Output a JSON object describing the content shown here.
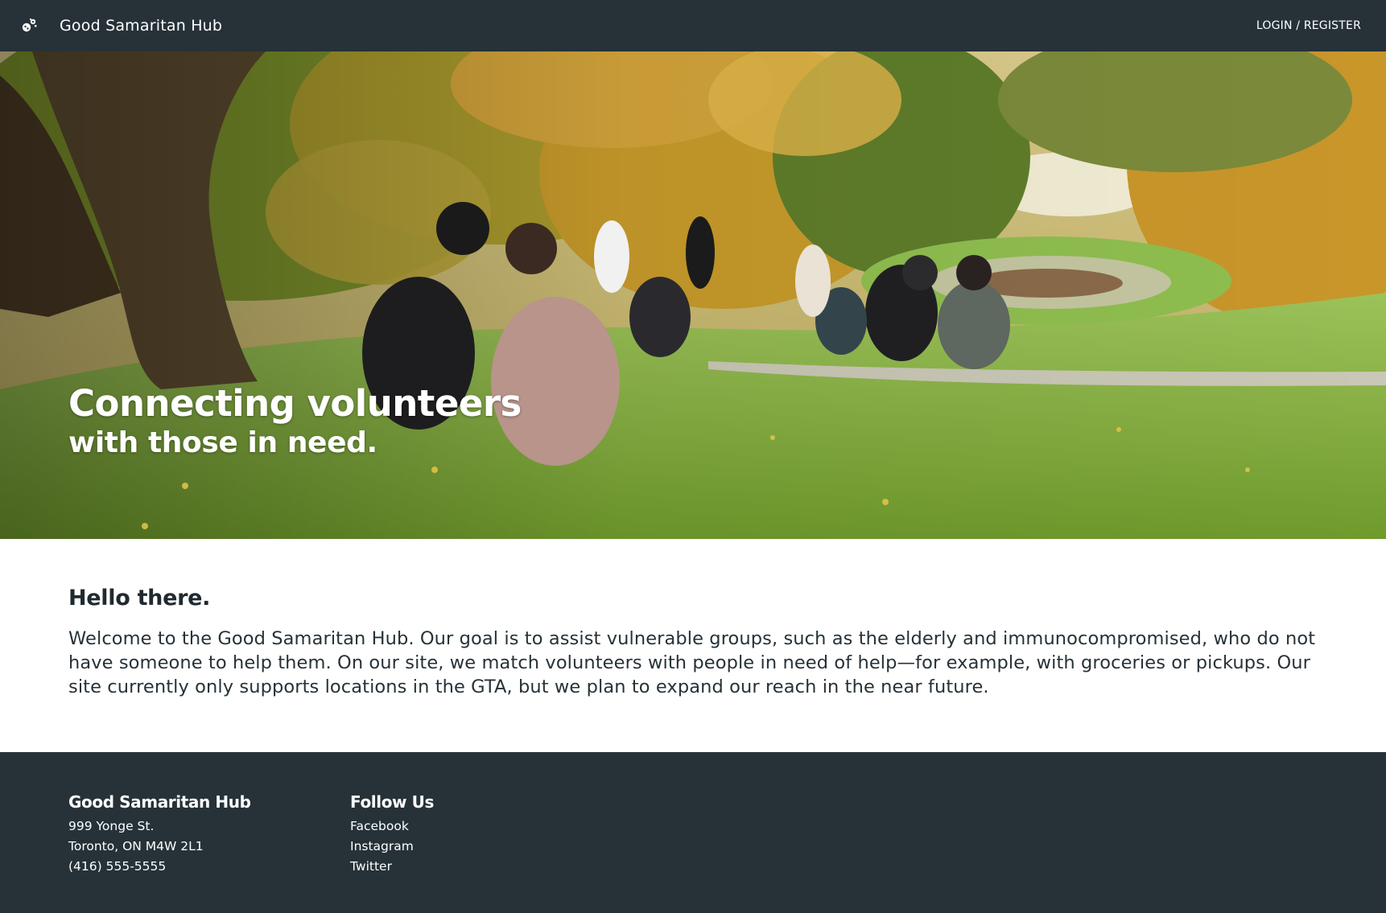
{
  "nav": {
    "brand_title": "Good Samaritan Hub",
    "brand_icon": "volunteer-hands-icon",
    "login_label": "LOGIN / REGISTER"
  },
  "hero": {
    "headline_line1": "Connecting volunteers",
    "headline_line2": "with those in need.",
    "image": "autumn-park-people-sitting-on-hill"
  },
  "intro": {
    "heading": "Hello there.",
    "body": "Welcome to the Good Samaritan Hub. Our goal is to assist vulnerable groups, such as the elderly and immunocompromised, who do not have someone to help them. On our site, we match volunteers with people in need of help—for example, with groceries or pickups. Our site currently only supports locations in the GTA, but we plan to expand our reach in the near future."
  },
  "footer": {
    "org_title": "Good Samaritan Hub",
    "address_line1": "999 Yonge St.",
    "address_line2": "Toronto, ON M4W 2L1",
    "phone": "(416) 555-5555",
    "follow_title": "Follow Us",
    "links": [
      "Facebook",
      "Instagram",
      "Twitter"
    ]
  },
  "colors": {
    "nav_bg": "#263238",
    "footer_bg": "#263238",
    "text_dark": "#263238",
    "text_light": "#ffffff"
  }
}
